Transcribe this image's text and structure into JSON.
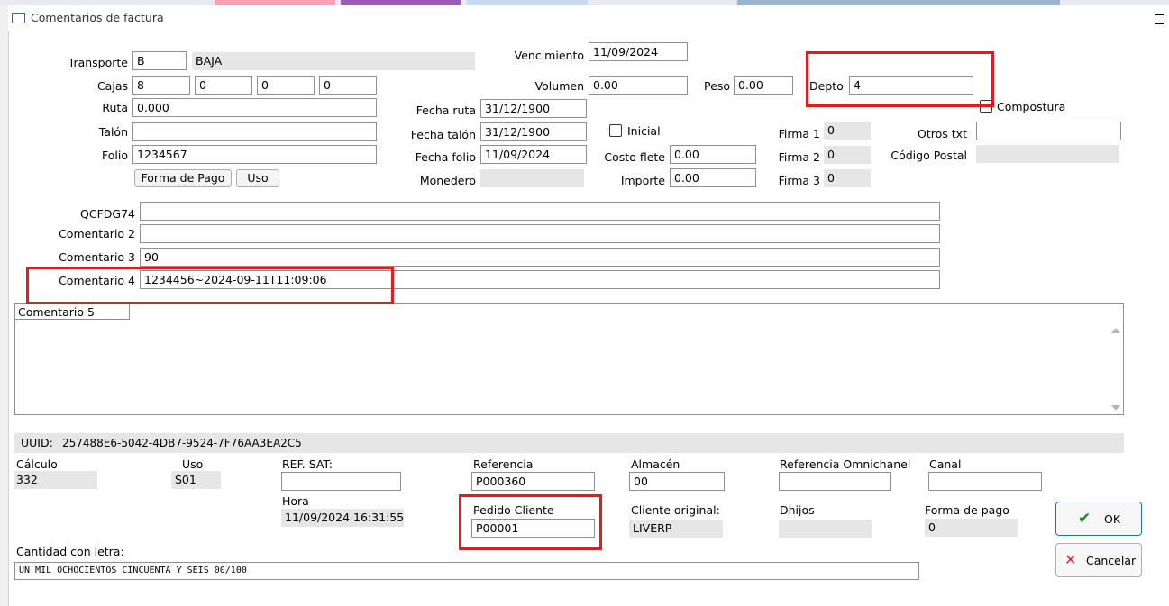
{
  "window": {
    "title": "Comentarios de factura"
  },
  "fields": {
    "transporte": {
      "label": "Transporte",
      "code": "B",
      "name": "BAJA"
    },
    "cajas": {
      "label": "Cajas",
      "values": [
        "8",
        "0",
        "0",
        "0"
      ]
    },
    "ruta": {
      "label": "Ruta",
      "value": "0.000"
    },
    "talon": {
      "label": "Talón",
      "value": ""
    },
    "folio": {
      "label": "Folio",
      "value": "1234567"
    },
    "forma_pago_btn": "Forma de Pago",
    "uso_btn": "Uso",
    "vencimiento": {
      "label": "Vencimiento",
      "value": "11/09/2024"
    },
    "volumen": {
      "label": "Volumen",
      "value": "0.00"
    },
    "peso": {
      "label": "Peso",
      "value": "0.00"
    },
    "depto": {
      "label": "Depto",
      "value": "4"
    },
    "compostura": {
      "label": "Compostura"
    },
    "fecha_ruta": {
      "label": "Fecha ruta",
      "value": "31/12/1900"
    },
    "inicial": {
      "label": "Inicial"
    },
    "fecha_talon": {
      "label": "Fecha talón",
      "value": "31/12/1900"
    },
    "fecha_folio": {
      "label": "Fecha folio",
      "value": "11/09/2024"
    },
    "costo_flete": {
      "label": "Costo flete",
      "value": "0.00"
    },
    "monedero": {
      "label": "Monedero",
      "value": ""
    },
    "importe": {
      "label": "Importe",
      "value": "0.00"
    },
    "firma1": {
      "label": "Firma 1",
      "value": "0"
    },
    "firma2": {
      "label": "Firma 2",
      "value": "0"
    },
    "firma3": {
      "label": "Firma 3",
      "value": "0"
    },
    "otros_txt": {
      "label": "Otros txt",
      "value": ""
    },
    "codigo_postal": {
      "label": "Código Postal",
      "value": ""
    }
  },
  "comments": {
    "qcfdg74": {
      "label": "QCFDG74",
      "value": ""
    },
    "c2": {
      "label": "Comentario 2",
      "value": ""
    },
    "c3": {
      "label": "Comentario 3",
      "value": "90"
    },
    "c4": {
      "label": "Comentario 4",
      "value": "1234456~2024-09-11T11:09:06"
    },
    "c5": {
      "label": "Comentario 5",
      "value": ""
    }
  },
  "bottom": {
    "uuid_label": "UUID:",
    "uuid_value": "257488E6-5042-4DB7-9524-7F76AA3EA2C5",
    "calculo": {
      "label": "Cálculo",
      "value": "332"
    },
    "uso": {
      "label": "Uso",
      "value": "S01"
    },
    "ref_sat": {
      "label": "REF. SAT:",
      "value": ""
    },
    "hora": {
      "label": "Hora",
      "value": "11/09/2024 16:31:55"
    },
    "referencia": {
      "label": "Referencia",
      "value": "P000360"
    },
    "pedido_cliente": {
      "label": "Pedido Cliente",
      "value": "P00001"
    },
    "almacen": {
      "label": "Almacén",
      "value": "00"
    },
    "cliente_original": {
      "label": "Cliente original:",
      "value": "LIVERP"
    },
    "ref_omnichanel": {
      "label": "Referencia Omnichanel",
      "value": ""
    },
    "canal": {
      "label": "Canal",
      "value": ""
    },
    "dhijos": {
      "label": "Dhijos",
      "value": ""
    },
    "forma_pago": {
      "label": "Forma de pago",
      "value": "0"
    },
    "cantidad_letra": {
      "label": "Cantidad con letra:",
      "value": "UN MIL OCHOCIENTOS CINCUENTA Y SEIS 00/100"
    }
  },
  "buttons": {
    "ok": "OK",
    "cancel": "Cancelar"
  },
  "colors": {
    "highlight": "#e8191b",
    "readonly_bg": "#e6e6e6",
    "ok_check": "#1a8a1a",
    "cancel_x": "#d9262b"
  }
}
